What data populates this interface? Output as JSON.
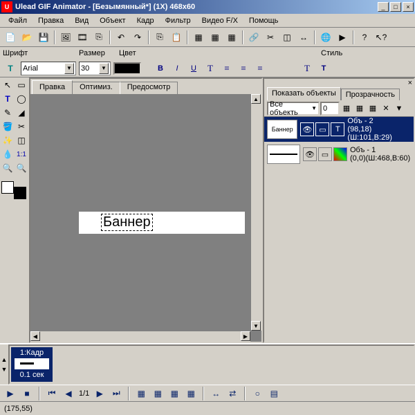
{
  "title": "Ulead GIF Animator - [Безымянный*] (1X) 468x60",
  "menu": [
    "Файл",
    "Правка",
    "Вид",
    "Объект",
    "Кадр",
    "Фильтр",
    "Видео F/X",
    "Помощь"
  ],
  "font": {
    "label": "Шрифт",
    "value": "Arial"
  },
  "size": {
    "label": "Размер",
    "value": "30"
  },
  "color": {
    "label": "Цвет"
  },
  "style": {
    "label": "Стиль"
  },
  "tabs": [
    "Правка",
    "Оптимиз.",
    "Предосмотр"
  ],
  "canvas_text": "Баннер",
  "rp": {
    "tab1": "Показать объекты",
    "tab2": "Прозрачность",
    "filter": "Все объекть",
    "opacity": "0",
    "objects": [
      {
        "thumb": "Баннер",
        "name": "Объ - 2",
        "coords": "(98,18)(Ш:101,В:29)",
        "sel": true,
        "type": "T"
      },
      {
        "thumb": "",
        "name": "Объ - 1",
        "coords": "(0,0)(Ш:468,В:60)",
        "sel": false,
        "type": "img"
      }
    ]
  },
  "frame": {
    "label": "1:Кадр",
    "time": "0.1 сек"
  },
  "play": {
    "pos": "1/1"
  },
  "status": "(175,55)"
}
